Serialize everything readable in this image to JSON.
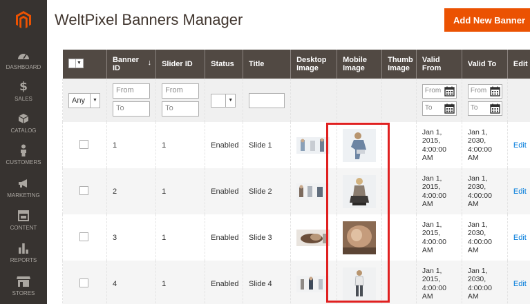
{
  "sidebar": {
    "items": [
      {
        "label": "DASHBOARD",
        "icon": "dashboard-icon"
      },
      {
        "label": "SALES",
        "icon": "dollar-icon"
      },
      {
        "label": "CATALOG",
        "icon": "box-icon"
      },
      {
        "label": "CUSTOMERS",
        "icon": "person-icon"
      },
      {
        "label": "MARKETING",
        "icon": "megaphone-icon"
      },
      {
        "label": "CONTENT",
        "icon": "layout-icon"
      },
      {
        "label": "REPORTS",
        "icon": "bar-chart-icon"
      },
      {
        "label": "STORES",
        "icon": "store-icon"
      }
    ]
  },
  "header": {
    "title": "WeltPixel Banners Manager",
    "add_button": "Add New Banner"
  },
  "grid": {
    "columns": {
      "banner_id": "Banner ID",
      "slider_id": "Slider ID",
      "status": "Status",
      "title": "Title",
      "desktop_image": "Desktop Image",
      "mobile_image": "Mobile Image",
      "thumb_image": "Thumb Image",
      "valid_from": "Valid From",
      "valid_to": "Valid To",
      "action": "Edit"
    },
    "filters": {
      "any": "Any",
      "from": "From",
      "to": "To"
    },
    "rows": [
      {
        "banner_id": "1",
        "slider_id": "1",
        "status": "Enabled",
        "title": "Slide 1",
        "valid_from": "Jan 1, 2015, 4:00:00 AM",
        "valid_to": "Jan 1, 2030, 4:00:00 AM",
        "edit": "Edit"
      },
      {
        "banner_id": "2",
        "slider_id": "1",
        "status": "Enabled",
        "title": "Slide 2",
        "valid_from": "Jan 1, 2015, 4:00:00 AM",
        "valid_to": "Jan 1, 2030, 4:00:00 AM",
        "edit": "Edit"
      },
      {
        "banner_id": "3",
        "slider_id": "1",
        "status": "Enabled",
        "title": "Slide 3",
        "valid_from": "Jan 1, 2015, 4:00:00 AM",
        "valid_to": "Jan 1, 2030, 4:00:00 AM",
        "edit": "Edit"
      },
      {
        "banner_id": "4",
        "slider_id": "1",
        "status": "Enabled",
        "title": "Slide 4",
        "valid_from": "Jan 1, 2015, 4:00:00 AM",
        "valid_to": "Jan 1, 2030, 4:00:00 AM",
        "edit": "Edit"
      }
    ]
  },
  "colors": {
    "accent": "#eb5202",
    "sidebar_bg": "#373330",
    "header_bg": "#514943",
    "highlight": "#e02020",
    "link": "#007bdb"
  }
}
